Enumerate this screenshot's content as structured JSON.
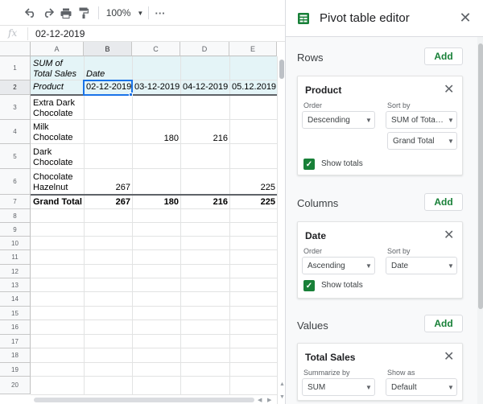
{
  "toolbar": {
    "zoom": "100%",
    "more": "···"
  },
  "formula_bar": {
    "fx": "fx",
    "value": "02-12-2019"
  },
  "sheet": {
    "columns": [
      "A",
      "B",
      "C",
      "D",
      "E"
    ],
    "rows": [
      "1",
      "2",
      "3",
      "4",
      "5",
      "6",
      "7",
      "8",
      "9",
      "10",
      "11",
      "12",
      "13",
      "14",
      "15",
      "16",
      "17",
      "18",
      "19",
      "20"
    ],
    "pivot": {
      "values_label": "SUM of Total Sales",
      "values_label_1": "SUM of",
      "values_label_2": "Total Sales",
      "col_field": "Date",
      "row_field": "Product",
      "dates": [
        "02-12-2019",
        "03-12-2019",
        "04-12-2019",
        "05.12.2019"
      ],
      "products": [
        {
          "name_1": "Extra Dark",
          "name_2": "Chocolate",
          "values": [
            "",
            "",
            "",
            ""
          ]
        },
        {
          "name_1": "Milk",
          "name_2": "Chocolate",
          "values": [
            "",
            "180",
            "216",
            ""
          ]
        },
        {
          "name_1": "Dark",
          "name_2": "Chocolate",
          "values": [
            "",
            "",
            "",
            ""
          ]
        },
        {
          "name_1": "Chocolate",
          "name_2": "Hazelnut",
          "values": [
            "267",
            "",
            "",
            "225"
          ]
        }
      ],
      "grand_total_label": "Grand Total",
      "grand_totals": [
        "267",
        "180",
        "216",
        "225"
      ]
    }
  },
  "panel": {
    "title": "Pivot table editor",
    "rows": {
      "label": "Rows",
      "add": "Add",
      "card": {
        "title": "Product",
        "order_label": "Order",
        "order_value": "Descending",
        "sort_label": "Sort by",
        "sort_value": "SUM of Total ...",
        "sort_sub_value": "Grand Total",
        "show_totals": "Show totals"
      }
    },
    "columns": {
      "label": "Columns",
      "add": "Add",
      "card": {
        "title": "Date",
        "order_label": "Order",
        "order_value": "Ascending",
        "sort_label": "Sort by",
        "sort_value": "Date",
        "show_totals": "Show totals"
      }
    },
    "values": {
      "label": "Values",
      "add": "Add",
      "card": {
        "title": "Total Sales",
        "summarize_label": "Summarize by",
        "summarize_value": "SUM",
        "show_as_label": "Show as",
        "show_as_value": "Default"
      }
    }
  },
  "colors": {
    "accent_green": "#188038",
    "selection_blue": "#1a73e8",
    "pivot_header_bg": "#e4f4f7"
  }
}
